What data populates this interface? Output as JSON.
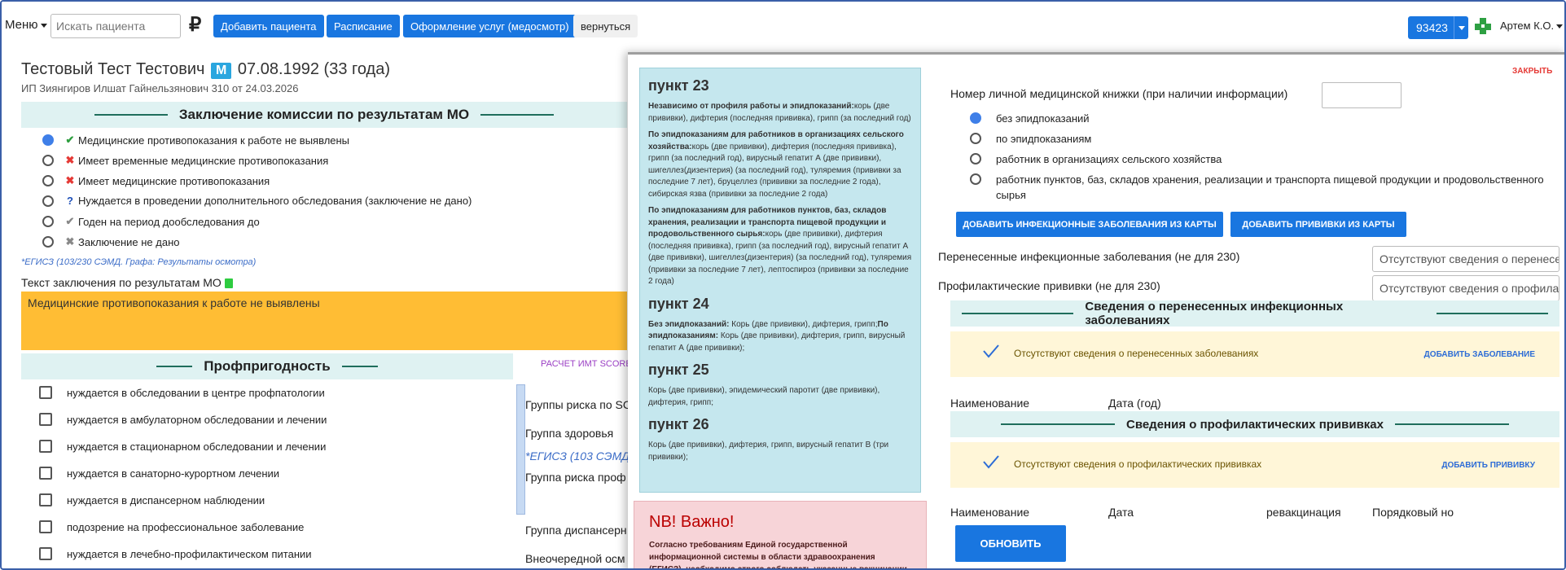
{
  "topbar": {
    "menu_label": "Меню",
    "search_placeholder": "Искать пациента",
    "ruble_symbol": "₽",
    "add_patient": "Добавить пациента",
    "schedule": "Расписание",
    "services": "Оформление услуг (медосмотр)",
    "back": "вернуться",
    "account_number": "93423",
    "user_name": "Артем К.О.",
    "accent_color": "#1976e0"
  },
  "patient": {
    "name": "Тестовый Тест Тестович",
    "gender_badge": "М",
    "dob": "07.08.1992 (33 года)",
    "clinic": "ИП Зиянгиров Илшат Гайнельзянович 310 от 24.03.2026"
  },
  "commission": {
    "title": "Заключение комиссии по результатам МО",
    "options": [
      {
        "icon": "✔",
        "icon_name": "check-icon",
        "color": "#2e9e3f",
        "label": "Медицинские противопоказания к работе не выявлены",
        "selected": true
      },
      {
        "icon": "✖",
        "icon_name": "cross-icon",
        "color": "#e53935",
        "label": "Имеет временные медицинские противопоказания",
        "selected": false
      },
      {
        "icon": "✖",
        "icon_name": "cross-icon",
        "color": "#e53935",
        "label": "Имеет медицинские противопоказания",
        "selected": false
      },
      {
        "icon": "?",
        "icon_name": "question-icon",
        "color": "#1d4fb8",
        "label": "Нуждается в проведении дополнительного обследования (заключение не дано)",
        "selected": false
      },
      {
        "icon": "✔",
        "icon_name": "check-icon",
        "color": "#888888",
        "label": "Годен на период дообследования до",
        "selected": false
      },
      {
        "icon": "✖",
        "icon_name": "cross-icon",
        "color": "#888888",
        "label": "Заключение не дано",
        "selected": false
      }
    ],
    "egisz_note": "*ЕГИСЗ (103/230 СЭМД. Графа: Результаты осмотра)",
    "text_label": "Текст заключения по результатам МО",
    "text_value": "Медицинские противопоказания к работе не выявлены"
  },
  "fitness": {
    "title": "Профпригодность",
    "imt_link": "РАСЧЕТ ИМТ SCORE",
    "checks": [
      "нуждается в обследовании в центре профпатологии",
      "нуждается в амбулаторном обследовании и лечении",
      "нуждается в стационарном обследовании и лечении",
      "нуждается в санаторно-курортном лечении",
      "нуждается в диспансерном наблюдении",
      "подозрение на профессиональное заболевание",
      "нуждается в лечебно-профилактическом питании"
    ],
    "right_items": {
      "risk_groups": "Группы риска по SC",
      "health_group": "Группа здоровья",
      "egisz": "*ЕГИСЗ (103 СЭМД. Гра",
      "risk_group_prof": "Группа риска проф",
      "dispensary_group": "Группа диспансерн",
      "extraordinary": "Внеочередной осм"
    }
  },
  "modal": {
    "close": "ЗАКРЫТЬ",
    "info": {
      "p23_title": "пункт 23",
      "p23_a_bold": "Независимо от профиля работы и эпидпоказаний:",
      "p23_a": "корь (две прививки), дифтерия (последняя прививка), грипп (за последний год)",
      "p23_b_bold": "По эпидпоказаниям для работников в организациях сельского хозяйства:",
      "p23_b": "корь (две прививки), дифтерия (последняя прививка), грипп (за последний год), вирусный гепатит А (две прививки), шигеллез(дизентерия) (за последний год), туляремия (прививки за последние 7 лет), бруцеллез (прививки за последние 2 года), сибирская язва (прививки за последние 2 года)",
      "p23_c_bold": "По эпидпоказаниям для работников пунктов, баз, складов хранения, реализации и транспорта пищевой продукции и продовольственного сырья:",
      "p23_c": "корь (две прививки), дифтерия (последняя прививка), грипп (за последний год), вирусный гепатит А (две прививки), шигеллез(дизентерия) (за последний год), туляремия (прививки за последние 7 лет), лептоспироз (прививки за последние 2 года)",
      "p24_title": "пункт 24",
      "p24_a_bold": "Без эпидпоказаний:",
      "p24_a": " Корь (две прививки), дифтерия, грипп;",
      "p24_b_bold": "По эпидпоказаниям:",
      "p24_b": " Корь (две прививки), дифтерия, грипп, вирусный гепатит А (две прививки);",
      "p25_title": "пункт 25",
      "p25": " Корь (две прививки), эпидемический паротит (две прививки), дифтерия, грипп;",
      "p26_title": "пункт 26",
      "p26": " Корь (две прививки), дифтерия, грипп, вирусный гепатит В (три прививки);"
    },
    "nb": {
      "title": "NB! Важно!",
      "text": "Согласно требованиям Единой государственной информационной системы в области здравоохранения (ЕГИСЗ), необходимо строго соблюдать указанные вакцинации по"
    },
    "med_book_label": "Номер личной медицинской книжки (при наличии информации)",
    "epid_options": [
      {
        "label": "без эпидпоказаний",
        "selected": true
      },
      {
        "label": "по эпидпоказаниям",
        "selected": false
      },
      {
        "label": "работник в организациях сельского хозяйства",
        "selected": false
      },
      {
        "label": "работник пунктов, баз, складов хранения, реализации и транспорта пищевой продукции и продовольственного сырья",
        "selected": false
      }
    ],
    "add_infections_btn": "ДОБАВИТЬ ИНФЕКЦИОННЫЕ ЗАБОЛЕВАНИЯ ИЗ КАРТЫ",
    "add_vaccines_btn": "ДОБАВИТЬ ПРИВИВКИ ИЗ КАРТЫ",
    "past_infections_label": "Перенесенные инфекционные заболевания (не для 230)",
    "past_infections_value": "Отсутствуют сведения о перенесенных",
    "vaccines_label": "Профилактические прививки (не для 230)",
    "vaccines_value": "Отсутствуют сведения о профилактических",
    "infections_section": {
      "title": "Сведения о перенесенных инфекционных заболеваниях",
      "note": "Отсутствуют сведения о перенесенных заболеваниях",
      "add": "ДОБАВИТЬ ЗАБОЛЕВАНИЕ",
      "cols": [
        "Наименование",
        "Дата (год)"
      ]
    },
    "vaccines_section": {
      "title": "Сведения о профилактических прививках",
      "note": "Отсутствуют сведения о профилактических прививках",
      "add": "ДОБАВИТЬ ПРИВИВКУ",
      "cols": [
        "Наименование",
        "Дата",
        "ревакцинация",
        "Порядковый но"
      ]
    },
    "update_btn": "ОБНОВИТЬ"
  }
}
